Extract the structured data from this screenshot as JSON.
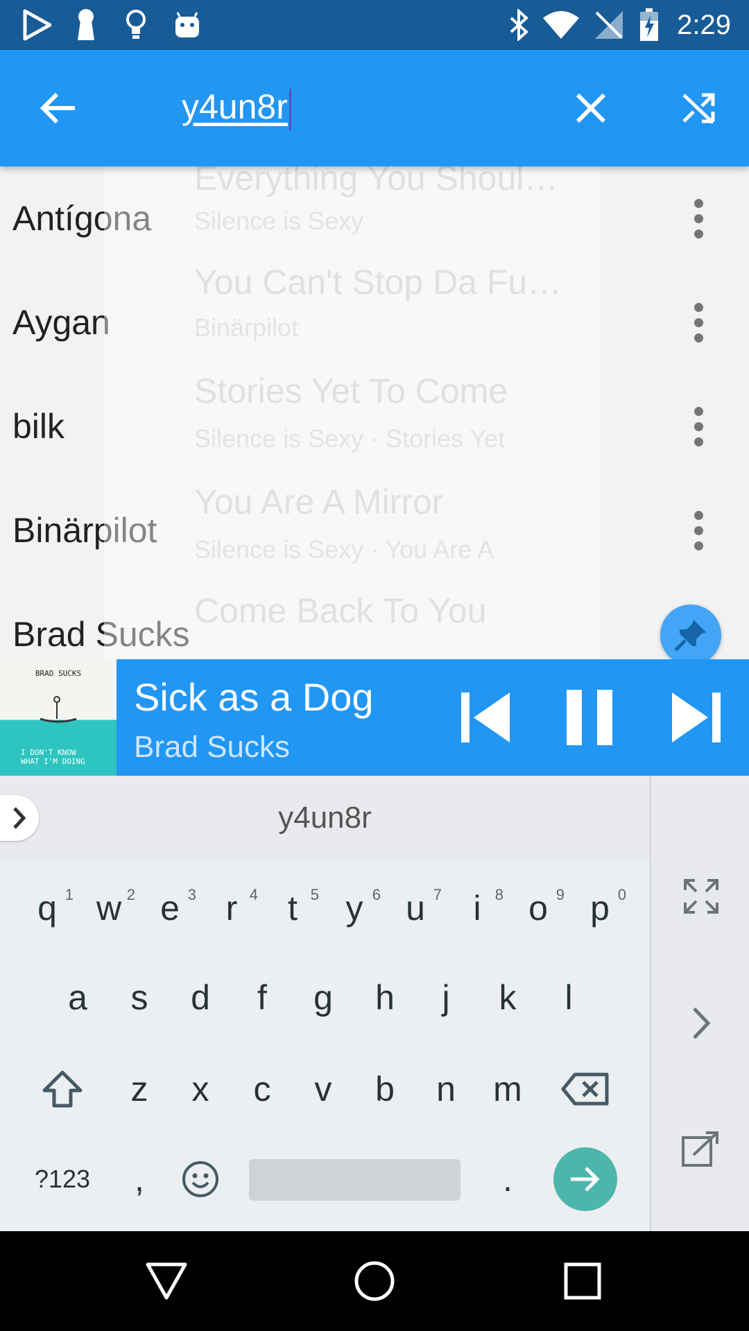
{
  "status_bar": {
    "time": "2:29",
    "left_icons": [
      "play-store-icon",
      "keyhole-icon",
      "lightbulb-icon",
      "android-icon"
    ],
    "right_icons": [
      "bluetooth-icon",
      "wifi-icon",
      "no-signal-icon",
      "battery-charging-icon"
    ]
  },
  "app_bar": {
    "search_query": "y4un8r",
    "back_icon": "arrow-back-icon",
    "clear_icon": "close-icon",
    "shuffle_icon": "shuffle-icon"
  },
  "artists": [
    {
      "name": "Antígona"
    },
    {
      "name": "Aygan"
    },
    {
      "name": "bilk"
    },
    {
      "name": "Binärpilot"
    },
    {
      "name": "Brad Sucks"
    }
  ],
  "ghost_items": [
    {
      "title": "Everything You Shoul…",
      "sub": "Silence is Sexy"
    },
    {
      "title": "You Can't Stop Da Fu…",
      "sub": "Binärpilot"
    },
    {
      "title": "Stories Yet To Come",
      "sub": "Silence is Sexy · Stories Yet"
    },
    {
      "title": "You Are A Mirror",
      "sub": "Silence is Sexy · You Are A"
    },
    {
      "title": "Come Back To You",
      "sub": ""
    }
  ],
  "now_playing": {
    "title": "Sick as a Dog",
    "artist": "Brad Sucks",
    "album_art_top": "BRAD SUCKS",
    "album_art_bottom_1": "I DON'T KNOW",
    "album_art_bottom_2": "WHAT I'M DOING"
  },
  "keyboard": {
    "suggestion": "y4un8r",
    "row1": [
      {
        "k": "q",
        "h": "1"
      },
      {
        "k": "w",
        "h": "2"
      },
      {
        "k": "e",
        "h": "3"
      },
      {
        "k": "r",
        "h": "4"
      },
      {
        "k": "t",
        "h": "5"
      },
      {
        "k": "y",
        "h": "6"
      },
      {
        "k": "u",
        "h": "7"
      },
      {
        "k": "i",
        "h": "8"
      },
      {
        "k": "o",
        "h": "9"
      },
      {
        "k": "p",
        "h": "0"
      }
    ],
    "row2": [
      "a",
      "s",
      "d",
      "f",
      "g",
      "h",
      "j",
      "k",
      "l"
    ],
    "row3": [
      "z",
      "x",
      "c",
      "v",
      "b",
      "n",
      "m"
    ],
    "symbols_label": "?123",
    "comma": ",",
    "period": "."
  },
  "colors": {
    "status_bar": "#175b97",
    "primary": "#2196f3",
    "enter_key": "#4db6ac"
  }
}
